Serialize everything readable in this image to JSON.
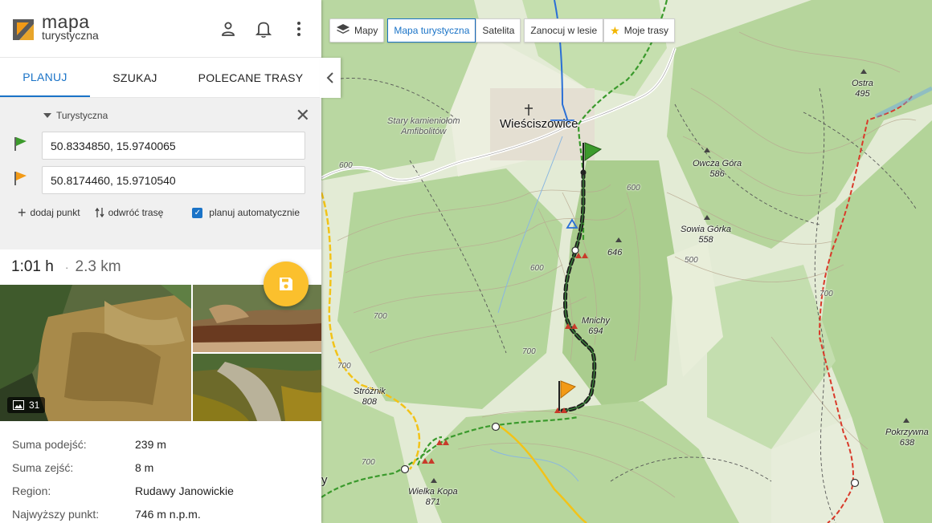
{
  "app": {
    "logo_line1": "mapa",
    "logo_line2": "turystyczna"
  },
  "tabs": [
    "PLANUJ",
    "SZUKAJ",
    "POLECANE TRASY"
  ],
  "planner": {
    "route_type": "Turystyczna",
    "start_point": "50.8334850, 15.9740065",
    "end_point": "50.8174460, 15.9710540",
    "add_point": "dodaj punkt",
    "reverse_route": "odwróć trasę",
    "auto_plan": "planuj automatycznie",
    "auto_plan_checked": true
  },
  "summary": {
    "time": "1:01 h",
    "distance": "2.3 km"
  },
  "photos": {
    "count": "31"
  },
  "stats": [
    {
      "label": "Suma podejść:",
      "value": "239 m"
    },
    {
      "label": "Suma zejść:",
      "value": "8 m"
    },
    {
      "label": "Region:",
      "value": "Rudawy Janowickie"
    },
    {
      "label": "Najwyższy punkt:",
      "value": "746 m n.p.m."
    }
  ],
  "map": {
    "layers": {
      "maps": "Mapy",
      "tourist_map": "Mapa turystyczna",
      "satellite": "Satelita",
      "camp": "Zanocuj w lesie",
      "my_routes": "Moje trasy"
    },
    "labels": {
      "town": "Wieściszowice",
      "quarry": "Stary kamieniołom\nAmfibolitów",
      "owcza": "Owcza Góra\n586",
      "sowia": "Sowia Górka\n558",
      "ostra": "Ostra\n495",
      "mnichy": "Mnichy\n694",
      "peak646": "646",
      "stroznik": "Stróżnik\n808",
      "wielka_kopa": "Wielka Kopa\n871",
      "pokrzywna": "Pokrzywna\n638",
      "c600a": "600",
      "c600b": "600",
      "c600c": "600",
      "c700a": "700",
      "c700b": "700",
      "c700c": "700",
      "c700d": "700",
      "c700e": "700",
      "c500": "500",
      "edge_y": "y"
    }
  },
  "colors": {
    "accent": "#1a73c7",
    "fab": "#fbc02d",
    "route_start": "#2e7d32",
    "route_end": "#f29a16"
  }
}
